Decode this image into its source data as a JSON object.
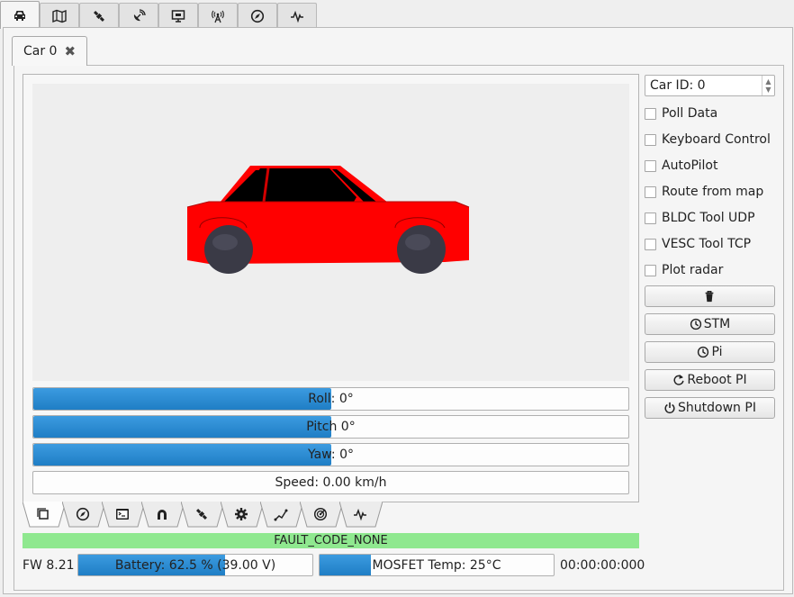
{
  "top_tabs": [
    {
      "icon": "car-icon",
      "active": true
    },
    {
      "icon": "map-icon",
      "active": false
    },
    {
      "icon": "satellite-icon",
      "active": false
    },
    {
      "icon": "antenna-dish-icon",
      "active": false
    },
    {
      "icon": "monitor-icon",
      "active": false
    },
    {
      "icon": "radio-tower-icon",
      "active": false
    },
    {
      "icon": "compass-icon",
      "active": false
    },
    {
      "icon": "pulse-icon",
      "active": false
    }
  ],
  "car_tab": {
    "label": "Car 0"
  },
  "attitude": {
    "roll": {
      "label": "Roll: 0°",
      "fraction": 0.5
    },
    "pitch": {
      "label": "Pitch 0°",
      "fraction": 0.5
    },
    "yaw": {
      "label": "Yaw: 0°",
      "fraction": 0.5
    },
    "speed": {
      "label": "Speed: 0.00 km/h",
      "fraction": 0
    }
  },
  "bottom_tabs": [
    {
      "icon": "copy-icon",
      "active": true
    },
    {
      "icon": "compass-icon",
      "active": false
    },
    {
      "icon": "terminal-icon",
      "active": false
    },
    {
      "icon": "magnet-icon",
      "active": false
    },
    {
      "icon": "satellite-icon",
      "active": false
    },
    {
      "icon": "gear-icon",
      "active": false
    },
    {
      "icon": "route-icon",
      "active": false
    },
    {
      "icon": "radar-icon",
      "active": false
    },
    {
      "icon": "pulse-icon",
      "active": false
    }
  ],
  "status": {
    "fault": "FAULT_CODE_NONE",
    "fault_color": "#8fe88f",
    "fw": "FW 8.21",
    "battery": {
      "label": "Battery: 62.5 % (39.00 V)",
      "fraction": 0.625
    },
    "mosfet": {
      "label": "MOSFET Temp: 25°C",
      "fraction": 0.22
    },
    "timer": "00:00:00:000"
  },
  "side": {
    "car_id": "Car ID: 0",
    "checks": [
      "Poll Data",
      "Keyboard Control",
      "AutoPilot",
      "Route from map",
      "BLDC Tool UDP",
      "VESC Tool TCP",
      "Plot radar"
    ],
    "buttons": [
      {
        "icon": "trash-icon",
        "label": ""
      },
      {
        "icon": "clock-icon",
        "label": "STM"
      },
      {
        "icon": "clock-icon",
        "label": "Pi"
      },
      {
        "icon": "reboot-icon",
        "label": "Reboot PI"
      },
      {
        "icon": "power-icon",
        "label": "Shutdown PI"
      }
    ]
  },
  "colors": {
    "car_body": "#ff0000",
    "bar_fill": "#2a8ad3"
  }
}
